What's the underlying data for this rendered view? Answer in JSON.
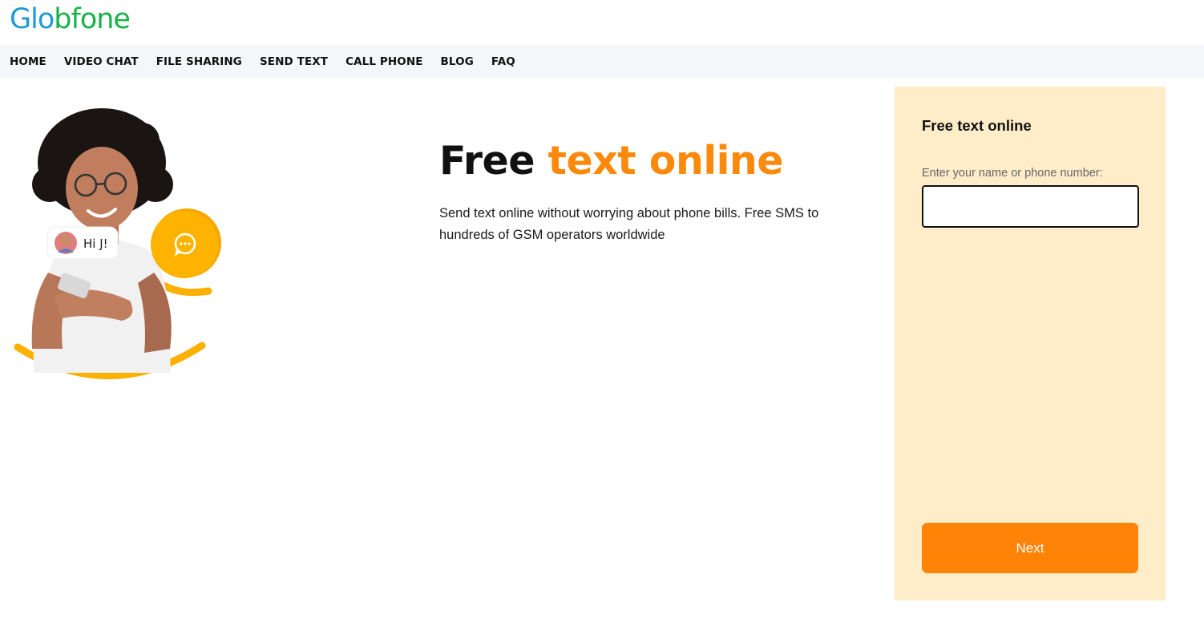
{
  "header": {
    "logo_part1": "Gl",
    "logo_part2": "o",
    "logo_part3": "bfone"
  },
  "nav": {
    "items": [
      {
        "label": "HOME"
      },
      {
        "label": "VIDEO CHAT"
      },
      {
        "label": "FILE SHARING"
      },
      {
        "label": "SEND TEXT"
      },
      {
        "label": "CALL PHONE"
      },
      {
        "label": "BLOG"
      },
      {
        "label": "FAQ"
      }
    ]
  },
  "hero": {
    "title_plain": "Free",
    "title_accent": "text online",
    "subtitle": "Send text online without worrying about phone bills. Free SMS to hundreds of GSM operators worldwide",
    "chat_bubble_text": "Hi J!"
  },
  "panel": {
    "title": "Free text online",
    "input_label": "Enter your name or phone number:",
    "input_value": "",
    "next_label": "Next"
  },
  "colors": {
    "accent": "#fb8a0c",
    "button": "#fe8306",
    "panel_bg": "#ffecc9",
    "logo_blue": "#1e9ad6",
    "logo_green": "#18b24a",
    "nav_bg": "#f5f6fa"
  }
}
